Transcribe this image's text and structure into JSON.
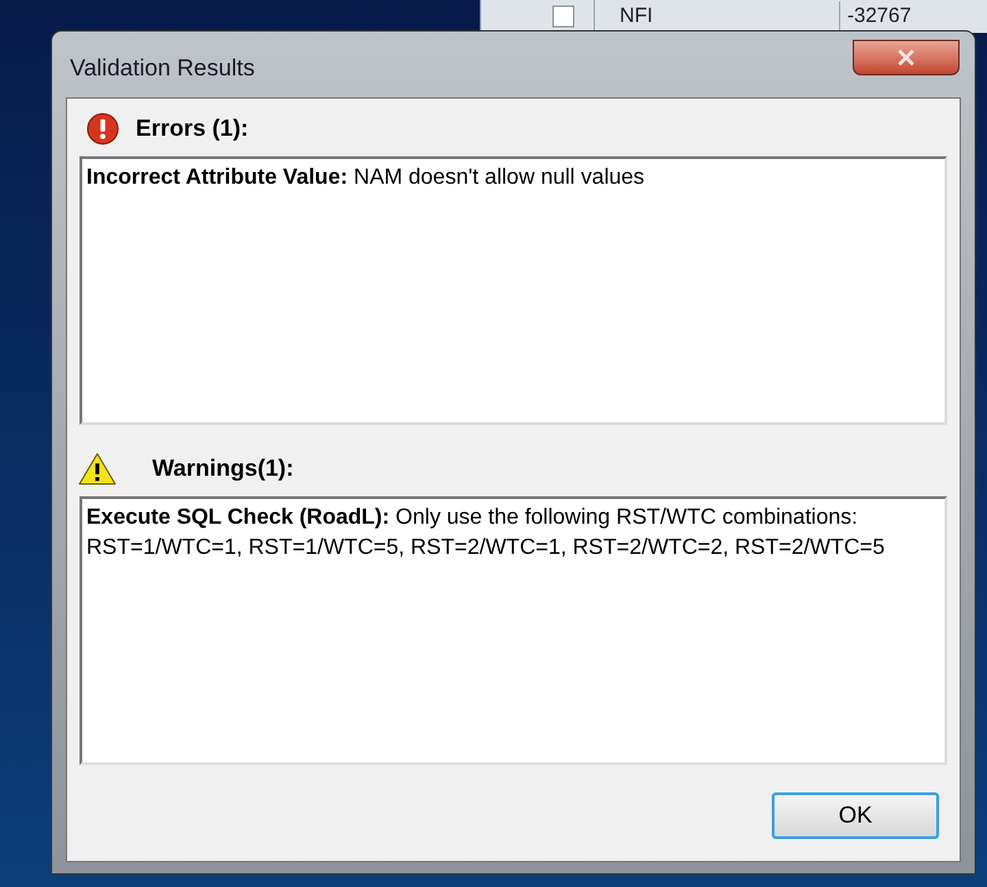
{
  "background_table": {
    "row": {
      "checked": false,
      "cells": [
        "NFI",
        "-32767"
      ]
    }
  },
  "window": {
    "title": "Validation Results"
  },
  "sections": [
    {
      "kind": "error",
      "heading": "Errors (1):",
      "message": "**Incorrect Attribute Value:** NAM doesn't allow null values"
    },
    {
      "kind": "warning",
      "heading": "Warnings(1):",
      "message": "**Execute SQL Check (RoadL):** Only use the following RST/WTC combinations: RST=1/WTC=1, RST=1/WTC=5, RST=2/WTC=1, RST=2/WTC=2, RST=2/WTC=5"
    }
  ],
  "buttons": [
    "OK"
  ]
}
